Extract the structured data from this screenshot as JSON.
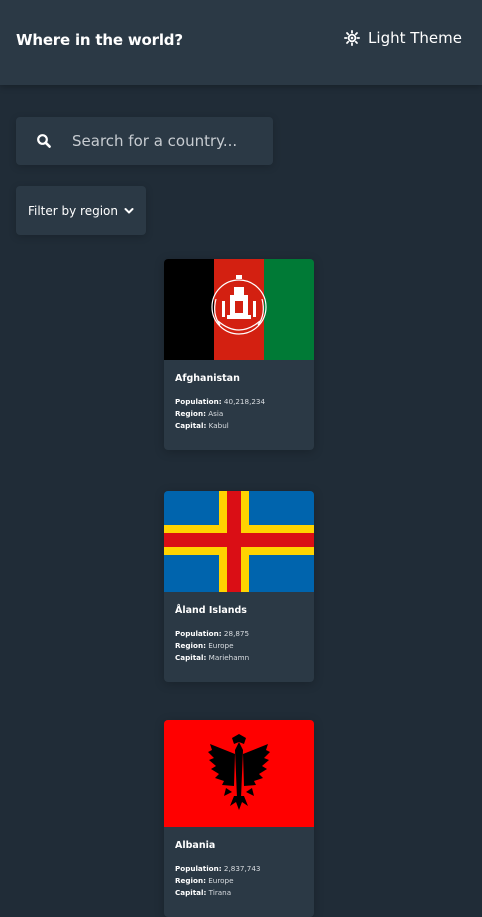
{
  "header": {
    "title": "Where in the world?",
    "theme_label": "Light Theme"
  },
  "search": {
    "placeholder": "Search for a country..."
  },
  "filter": {
    "label": "Filter by region"
  },
  "field_labels": {
    "population": "Population:",
    "region": "Region:",
    "capital": "Capital:"
  },
  "countries": [
    {
      "name": "Afghanistan",
      "population": "40,218,234",
      "region": "Asia",
      "capital": "Kabul",
      "flag_colors": [
        "#000000",
        "#d32011",
        "#007a36"
      ]
    },
    {
      "name": "Åland Islands",
      "population": "28,875",
      "region": "Europe",
      "capital": "Mariehamn",
      "flag_colors": [
        "#0064ad",
        "#ffd300",
        "#da0e15"
      ]
    },
    {
      "name": "Albania",
      "population": "2,837,743",
      "region": "Europe",
      "capital": "Tirana",
      "flag_colors": [
        "#ff0000",
        "#000000"
      ]
    }
  ],
  "colors": {
    "background": "#202c37",
    "surface": "#2b3945",
    "text": "#ffffff"
  }
}
